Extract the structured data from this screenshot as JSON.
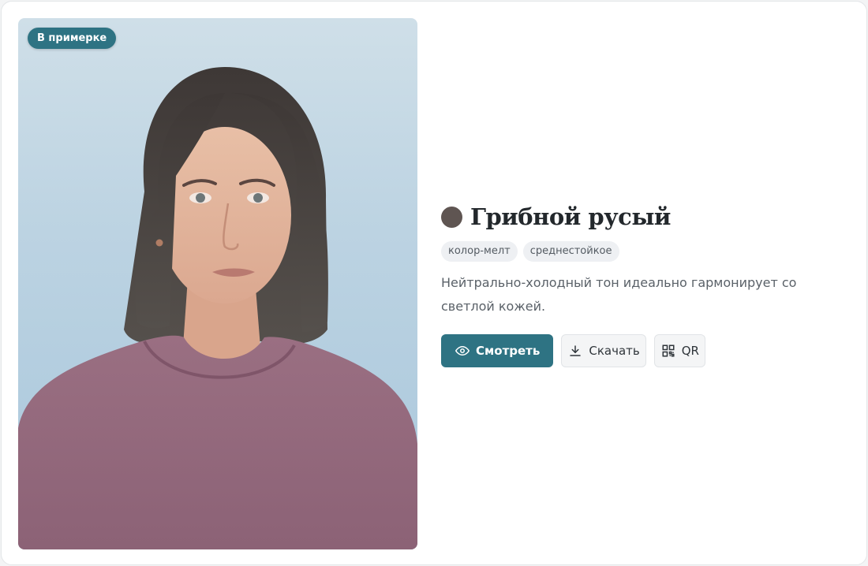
{
  "photo": {
    "badge": "В примерке",
    "alt": "Фото примерки"
  },
  "product": {
    "swatch_color": "#5f5552",
    "title": "Грибной русый",
    "tags": [
      "колор-мелт",
      "среднестойкое"
    ],
    "description": "Нейтрально-холодный тон идеально гармонирует со светлой кожей."
  },
  "actions": {
    "view_label": "Смотреть",
    "view_icon": "eye-icon",
    "download_label": "Скачать",
    "download_icon": "download-icon",
    "qr_label": "QR",
    "qr_icon": "qr-code-icon"
  },
  "colors": {
    "accent": "#2e7383",
    "shirt": "#956a7d",
    "hair": "#4a4341",
    "background": "#bcd3e2"
  }
}
